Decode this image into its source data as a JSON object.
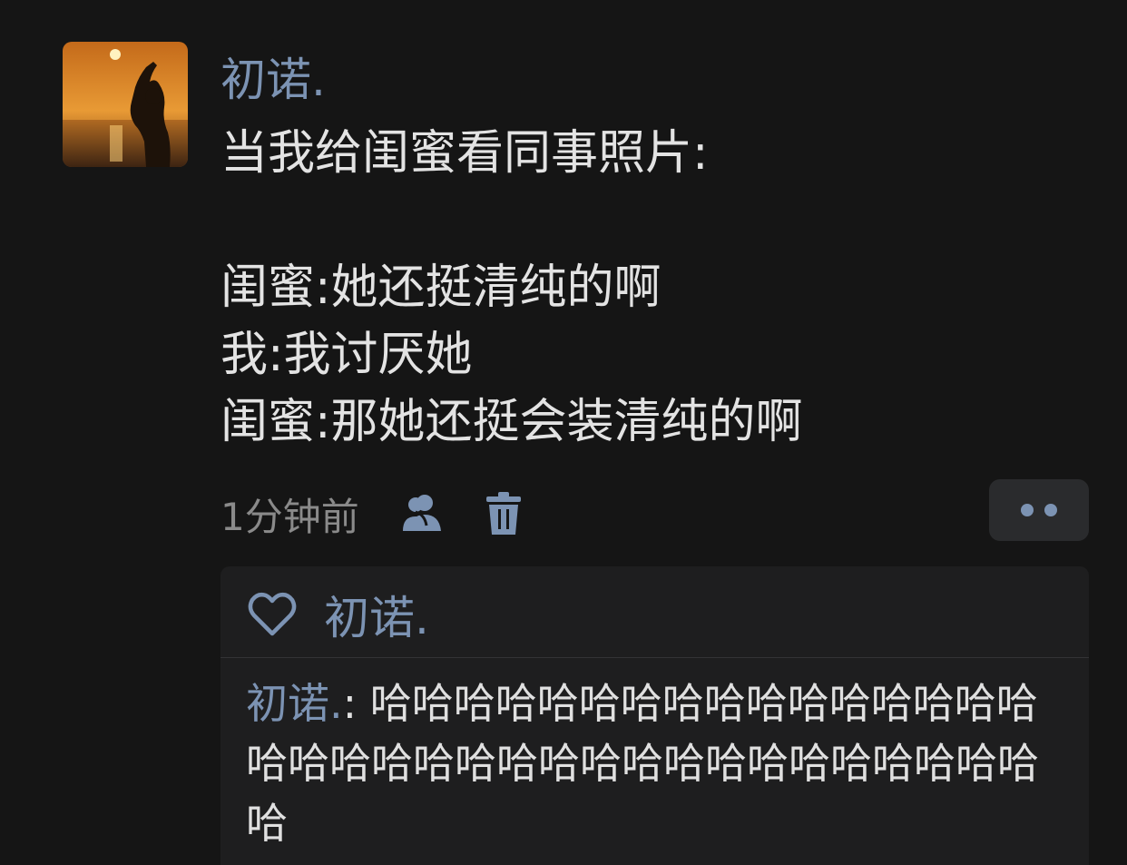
{
  "post": {
    "username": "初诺.",
    "text_lines": [
      "当我给闺蜜看同事照片:",
      "",
      "闺蜜:她还挺清纯的啊",
      "我:我讨厌她",
      "闺蜜:那她还挺会装清纯的啊"
    ],
    "timestamp": "1分钟前"
  },
  "icons": {
    "privacy": "people-icon",
    "delete": "trash-icon",
    "more": "more-dots-icon",
    "like": "heart-outline-icon"
  },
  "colors": {
    "background": "#151515",
    "accent": "#7c93b3",
    "text": "#e3e3e3",
    "muted": "#8a8a8a",
    "panel": "#1e1e1f"
  },
  "likes": {
    "names": "初诺."
  },
  "comments": [
    {
      "author": "初诺.",
      "separator": ": ",
      "text": "哈哈哈哈哈哈哈哈哈哈哈哈哈哈哈哈哈哈哈哈哈哈哈哈哈哈哈哈哈哈哈哈哈哈哈哈"
    }
  ]
}
